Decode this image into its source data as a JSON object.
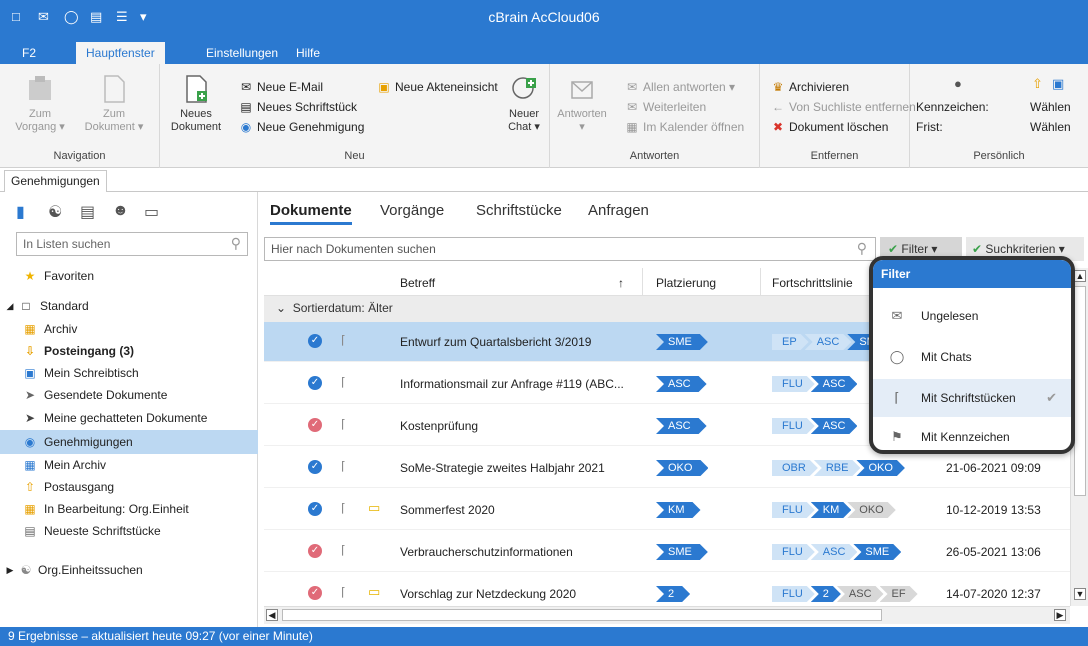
{
  "app": {
    "title": "cBrain AcCloud06"
  },
  "ribbon_tabs": [
    "F2",
    "Hauptfenster",
    "Einstellungen",
    "Hilfe"
  ],
  "ribbon": {
    "navigation": {
      "label": "Navigation",
      "zum_vorgang": "Zum",
      "zum_vorgang2": "Vorgang ▾",
      "zum_dokument": "Zum",
      "zum_dokument2": "Dokument ▾"
    },
    "neu": {
      "label": "Neu",
      "neues_dokument": "Neues",
      "neues_dokument2": "Dokument",
      "neue_email": "Neue E-Mail",
      "neues_schriftstueck": "Neues Schriftstück",
      "neue_genehmigung": "Neue Genehmigung",
      "neue_akteneinsicht": "Neue Akteneinsicht",
      "neuer_chat": "Neuer",
      "neuer_chat2": "Chat ▾"
    },
    "antworten": {
      "label": "Antworten",
      "antworten": "Antworten",
      "antworten2": "▾",
      "allen_antworten": "Allen antworten ▾",
      "weiterleiten": "Weiterleiten",
      "im_kalender": "Im Kalender öffnen"
    },
    "entfernen": {
      "label": "Entfernen",
      "archivieren": "Archivieren",
      "von_suchliste": "Von Suchliste entfernen",
      "dokument_loeschen": "Dokument löschen"
    },
    "persoenlich": {
      "label": "Persönlich",
      "kennzeichen": "Kennzeichen:",
      "frist": "Frist:",
      "waehlen1": "Wählen",
      "waehlen2": "Wählen"
    }
  },
  "doc_tab": "Genehmigungen",
  "left": {
    "search_placeholder": "In Listen suchen",
    "items": [
      {
        "label": "Favoriten"
      },
      {
        "label": "Standard"
      },
      {
        "label": "Archiv"
      },
      {
        "label": "Posteingang (3)"
      },
      {
        "label": "Mein Schreibtisch"
      },
      {
        "label": "Gesendete Dokumente"
      },
      {
        "label": "Meine gechatteten Dokumente"
      },
      {
        "label": "Genehmigungen"
      },
      {
        "label": "Mein Archiv"
      },
      {
        "label": "Postausgang"
      },
      {
        "label": "In Bearbeitung: Org.Einheit"
      },
      {
        "label": "Neueste Schriftstücke"
      },
      {
        "label": "Org.Einheitssuchen"
      }
    ]
  },
  "main_tabs": [
    "Dokumente",
    "Vorgänge",
    "Schriftstücke",
    "Anfragen"
  ],
  "doc_search_placeholder": "Hier nach Dokumenten suchen",
  "filter_label": "Filter ▾",
  "suchkriterien_label": "Suchkriterien ▾",
  "columns": {
    "betreff": "Betreff",
    "sort_arrow": "↑",
    "platzierung": "Platzierung",
    "fortschrittslinie": "Fortschrittslinie"
  },
  "group_label": "Sortierdatum: Älter",
  "rows": [
    {
      "status": "blue",
      "folder": false,
      "betreff": "Entwurf zum Quartalsbericht 3/2019",
      "platzierung": "SME",
      "fort": [
        [
          "EP",
          "done"
        ],
        [
          "ASC",
          "done"
        ],
        [
          "SME",
          "cur"
        ]
      ],
      "date": ""
    },
    {
      "status": "blue",
      "folder": false,
      "betreff": "Informationsmail zur Anfrage #119 (ABC...",
      "platzierung": "ASC",
      "fort": [
        [
          "FLU",
          "done"
        ],
        [
          "ASC",
          "cur"
        ]
      ],
      "date": ""
    },
    {
      "status": "red",
      "folder": false,
      "betreff": "Kostenprüfung",
      "platzierung": "ASC",
      "fort": [
        [
          "FLU",
          "done"
        ],
        [
          "ASC",
          "cur"
        ]
      ],
      "date": ""
    },
    {
      "status": "blue",
      "folder": false,
      "betreff": "SoMe-Strategie zweites Halbjahr 2021",
      "platzierung": "OKO",
      "fort": [
        [
          "OBR",
          "done"
        ],
        [
          "RBE",
          "done"
        ],
        [
          "OKO",
          "cur"
        ]
      ],
      "date": "21-06-2021 09:09"
    },
    {
      "status": "blue",
      "folder": true,
      "betreff": "Sommerfest 2020",
      "platzierung": "KM",
      "fort": [
        [
          "FLU",
          "done"
        ],
        [
          "KM",
          "cur"
        ],
        [
          "OKO",
          "todo"
        ]
      ],
      "date": "10-12-2019 13:53"
    },
    {
      "status": "red",
      "folder": false,
      "betreff": "Verbraucherschutzinformationen",
      "platzierung": "SME",
      "fort": [
        [
          "FLU",
          "done"
        ],
        [
          "ASC",
          "done"
        ],
        [
          "SME",
          "cur"
        ]
      ],
      "date": "26-05-2021 13:06"
    },
    {
      "status": "red",
      "folder": true,
      "betreff": "Vorschlag zur Netzdeckung 2020",
      "platzierung": "2",
      "fort": [
        [
          "FLU",
          "done"
        ],
        [
          "2",
          "cur"
        ],
        [
          "ASC",
          "todo"
        ],
        [
          "EF",
          "todo"
        ]
      ],
      "date": "14-07-2020 12:37"
    }
  ],
  "filter_menu": {
    "title": "Filter",
    "items": [
      {
        "label": "Ungelesen",
        "icon": "envelope-icon"
      },
      {
        "label": "Mit Chats",
        "icon": "chat-bubble-icon"
      },
      {
        "label": "Mit Schriftstücken",
        "icon": "paperclip-icon",
        "checked": true
      },
      {
        "label": "Mit Kennzeichen",
        "icon": "flag-icon"
      }
    ]
  },
  "status_bar": "9 Ergebnisse – aktualisiert heute 09:27 (vor einer Minute)",
  "colors": {
    "accent": "#2b79d0",
    "selected": "#bcd8f2",
    "status_red": "#e06a78",
    "status_blue": "#2b79d0"
  }
}
